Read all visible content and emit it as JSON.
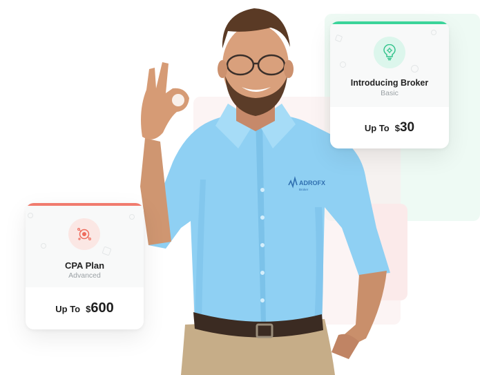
{
  "colors": {
    "broker_accent": "#3bd49a",
    "cpa_accent": "#f07b6e",
    "shirt": "#8fd0f3"
  },
  "brand": {
    "logo_text": "ADROFX",
    "logo_subtext": "Broker"
  },
  "cards": {
    "broker": {
      "icon": "lightbulb-gear-icon",
      "title": "Introducing Broker",
      "subtitle": "Basic",
      "price_prefix": "Up To",
      "currency": "$",
      "amount": "30"
    },
    "cpa": {
      "icon": "target-icon",
      "title": "CPA Plan",
      "subtitle": "Advanced",
      "price_prefix": "Up To",
      "currency": "$",
      "amount": "600"
    }
  }
}
